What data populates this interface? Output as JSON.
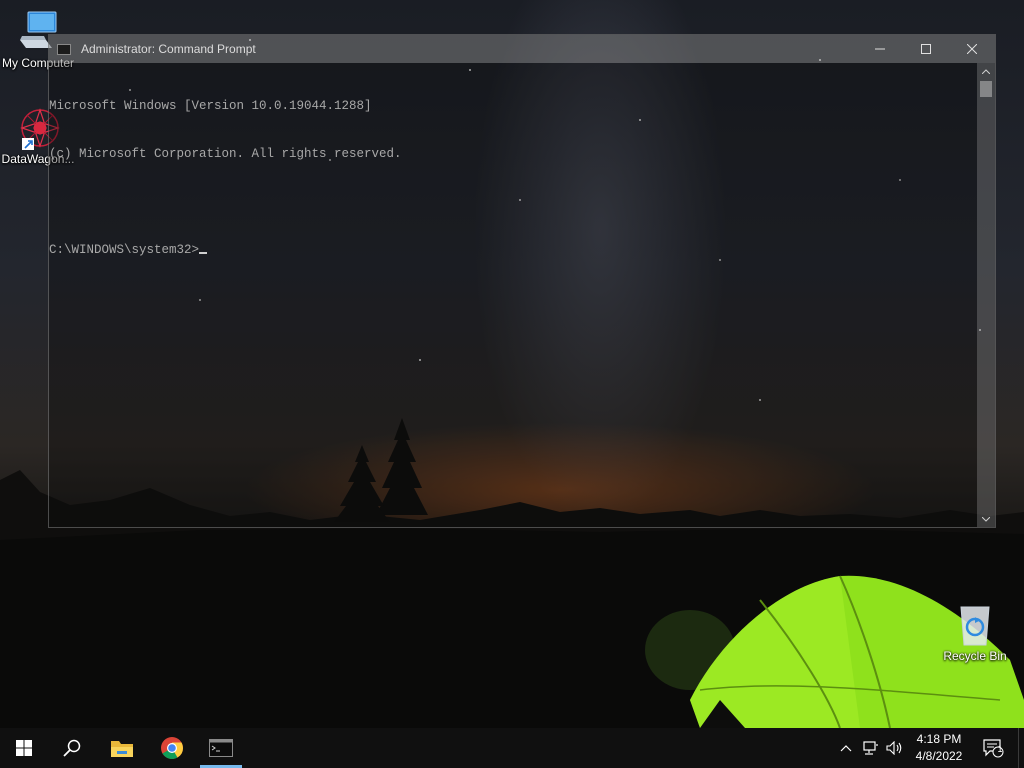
{
  "desktop": {
    "icons": [
      {
        "label": "My Computer",
        "icon": "computer-icon"
      },
      {
        "label": "DataWagon...",
        "icon": "datawagon-shortcut-icon"
      },
      {
        "label": "Recycle Bin",
        "icon": "recycle-bin-icon"
      }
    ]
  },
  "cmd_window": {
    "title": "Administrator: Command Prompt",
    "lines": [
      "Microsoft Windows [Version 10.0.19044.1288]",
      "(c) Microsoft Corporation. All rights reserved.",
      "",
      "C:\\WINDOWS\\system32>"
    ],
    "buttons": {
      "minimize": "minimize-icon",
      "maximize": "maximize-icon",
      "close": "close-icon"
    }
  },
  "taskbar": {
    "pinned": [
      "start-icon",
      "search-icon",
      "file-explorer-icon",
      "chrome-icon",
      "command-prompt-icon"
    ],
    "tray": {
      "icons": [
        "chevron-up-icon",
        "network-icon",
        "volume-icon"
      ],
      "time": "4:18 PM",
      "date": "4/8/2022",
      "notification_count": "1"
    }
  },
  "colors": {
    "taskbar_bg": "#101010",
    "active_indicator": "#76b9ed",
    "console_text": "#a8a8a8",
    "tent_green": "#8fe11c"
  }
}
